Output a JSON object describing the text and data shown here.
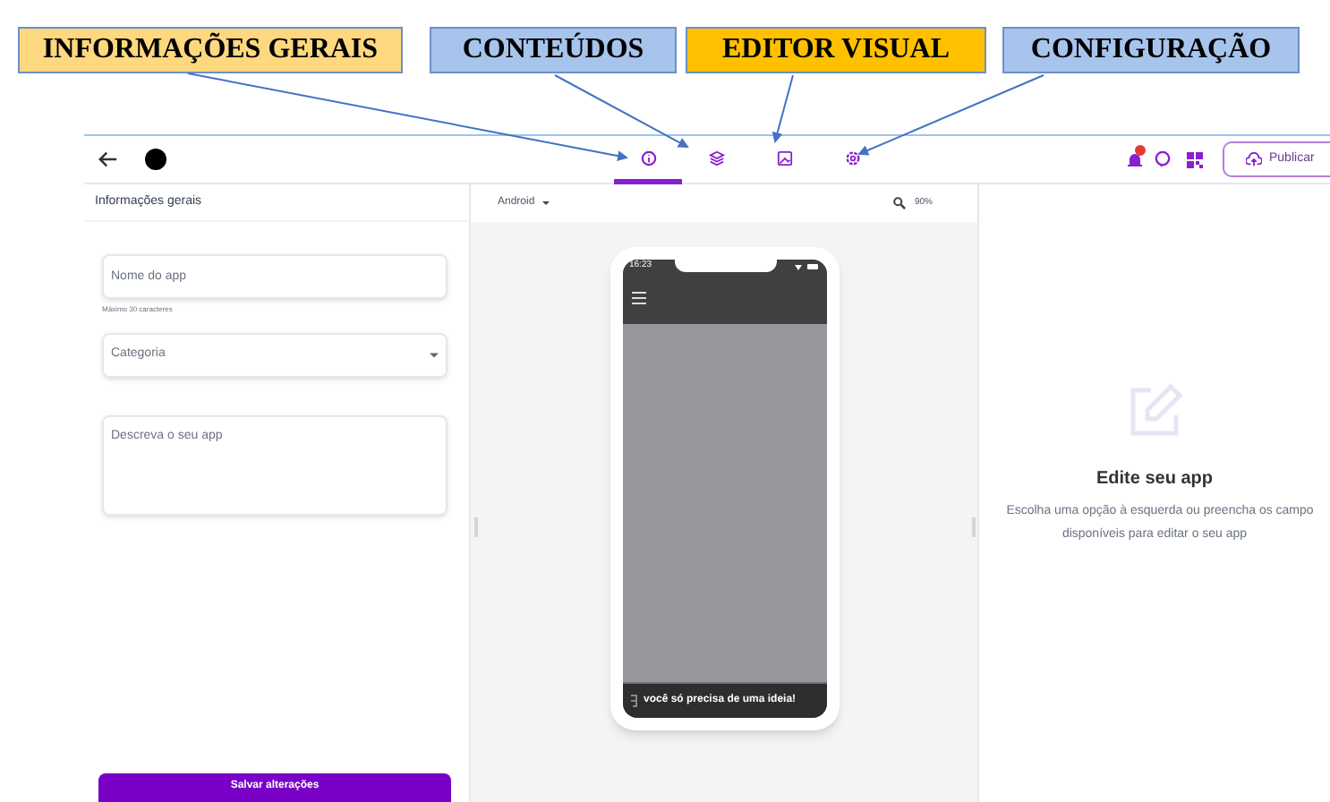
{
  "annotations": [
    {
      "label": "INFORMAÇÕES GERAIS",
      "color": "#fdd87e"
    },
    {
      "label": "CONTEÚDOS",
      "color": "#a7c4ec"
    },
    {
      "label": "EDITOR VISUAL",
      "color": "#ffc000"
    },
    {
      "label": "CONFIGURAÇÃO",
      "color": "#a7c4ec"
    }
  ],
  "tabs": [
    {
      "selected": true
    },
    {
      "selected": false
    },
    {
      "selected": false
    },
    {
      "selected": false
    }
  ],
  "header": {
    "publish_button": "Publicar"
  },
  "left_panel": {
    "title": "Informações gerais",
    "name_field": {
      "placeholder": "Nome do app",
      "helper": "Máximo 30 caracteres"
    },
    "category_field": {
      "placeholder": "Categoria"
    },
    "description_field": {
      "placeholder": "Descreva o seu app"
    },
    "save_button": "Salvar alterações"
  },
  "preview": {
    "platform": "Android",
    "zoom": "90%",
    "phone": {
      "time": "16:23",
      "banner": "você só precisa de uma ideia!"
    }
  },
  "right_panel": {
    "title": "Edite seu app",
    "description": "Escolha uma opção à esquerda ou preencha os campo",
    "description_line_2": "disponíveis para editar o seu app"
  }
}
